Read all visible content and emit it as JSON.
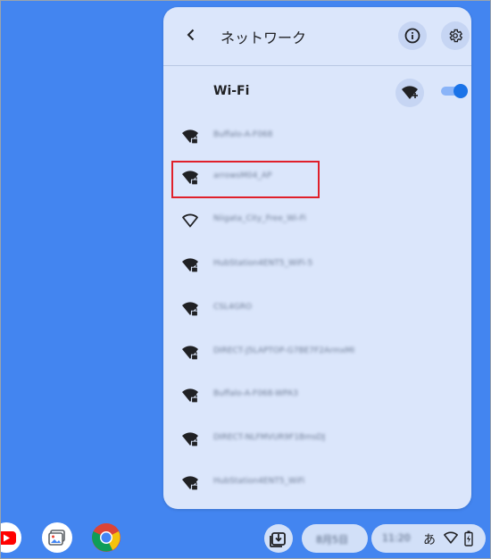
{
  "panel": {
    "title": "ネットワーク",
    "wifi_label": "Wi-Fi",
    "wifi_enabled": true,
    "accent_color": "#1a73e8"
  },
  "networks": [
    {
      "name": "Buffalo-A-F068",
      "signal": "full",
      "locked": true
    },
    {
      "name": "arrowsM04_AP",
      "signal": "full",
      "locked": true
    },
    {
      "name": "Niigata_City_Free_Wi-Fi",
      "signal": "outline",
      "locked": false
    },
    {
      "name": "HubStation4ENT5_WiFi-5",
      "signal": "full",
      "locked": true
    },
    {
      "name": "CSL4GRO",
      "signal": "full",
      "locked": true
    },
    {
      "name": "DIRECT-J5LAPTOP-G7BE7F2ArmxMI",
      "signal": "full",
      "locked": true
    },
    {
      "name": "Buffalo-A-F068-WPA3",
      "signal": "full",
      "locked": true
    },
    {
      "name": "DIRECT-NLFMVUR9F1BmsDJ",
      "signal": "full",
      "locked": true
    },
    {
      "name": "HubStation4ENT5_WiFi",
      "signal": "full",
      "locked": true
    }
  ],
  "shelf": {
    "date_label": "8月5日",
    "time_label": "11:20",
    "ime_label": "あ"
  }
}
